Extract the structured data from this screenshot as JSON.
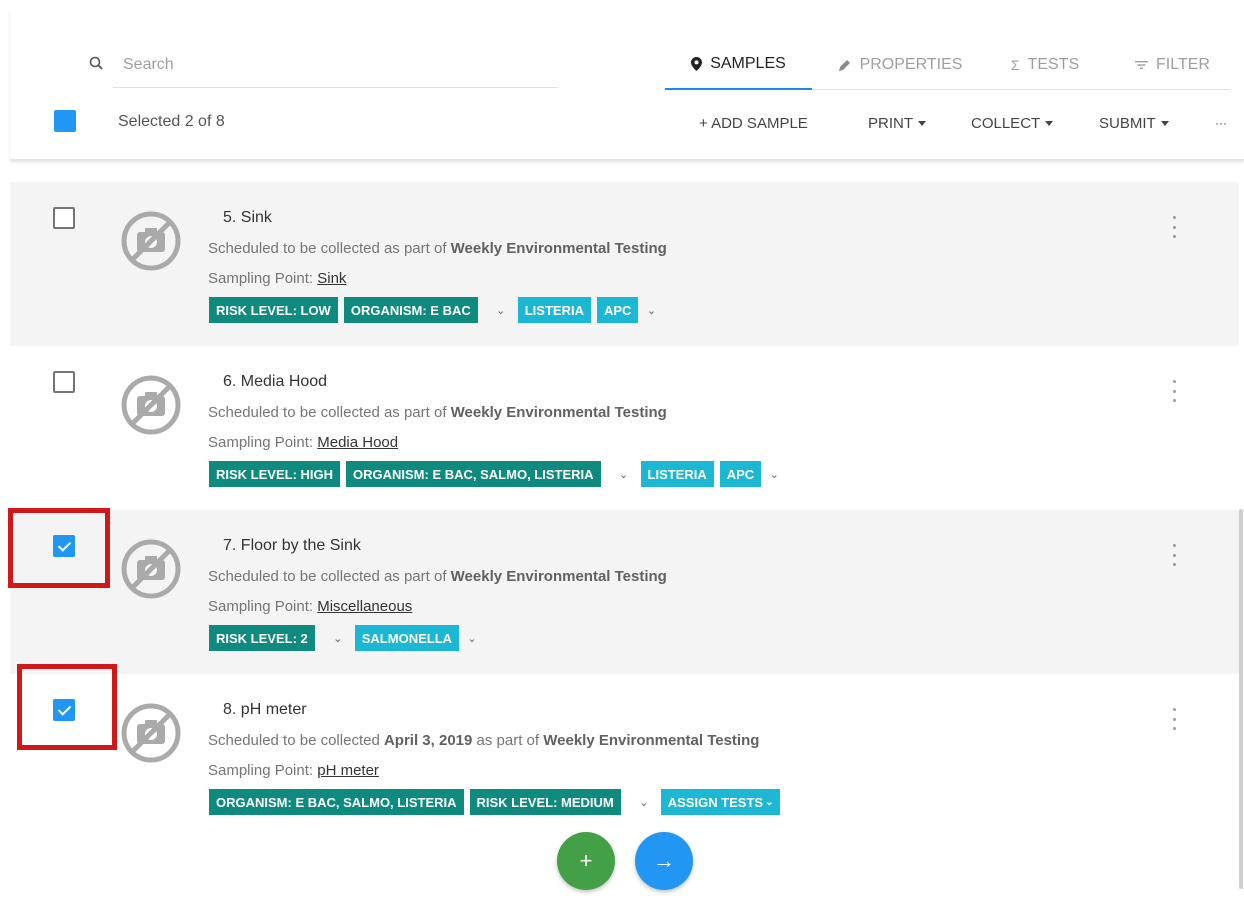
{
  "search": {
    "placeholder": "Search"
  },
  "tabs": [
    {
      "label": "SAMPLES",
      "icon": "map-pin-icon",
      "active": true
    },
    {
      "label": "PROPERTIES",
      "icon": "pencil-icon",
      "active": false
    },
    {
      "label": "TESTS",
      "icon": "sigma-icon",
      "active": false
    },
    {
      "label": "FILTER",
      "icon": "filter-lines-icon",
      "active": false
    }
  ],
  "selection": {
    "text": "Selected 2 of 8"
  },
  "actions": {
    "add_sample": "+ ADD SAMPLE",
    "print": "PRINT",
    "collect": "COLLECT",
    "submit": "SUBMIT",
    "more": "···"
  },
  "colors": {
    "accent": "#2196f3",
    "chip_teal": "#0f8a7e",
    "chip_cyan": "#1cb7d2",
    "highlight": "#d0181a",
    "fab_green": "#43a047"
  },
  "samples": [
    {
      "title": "5. Sink",
      "sched_prefix": "Scheduled to be collected as part of",
      "sched_date": "",
      "sched_plan": "Weekly Environmental Testing",
      "sp_label": "Sampling Point:",
      "sp_value": "Sink",
      "checked": false,
      "tags_a": [
        "RISK LEVEL: LOW",
        "ORGANISM: E BAC"
      ],
      "tags_b": [
        "LISTERIA",
        "APC"
      ]
    },
    {
      "title": "6. Media Hood",
      "sched_prefix": "Scheduled to be collected as part of",
      "sched_date": "",
      "sched_plan": "Weekly Environmental Testing",
      "sp_label": "Sampling Point:",
      "sp_value": "Media Hood",
      "checked": false,
      "tags_a": [
        "RISK LEVEL: HIGH",
        "ORGANISM: E BAC, SALMO, LISTERIA"
      ],
      "tags_b": [
        "LISTERIA",
        "APC"
      ]
    },
    {
      "title": "7. Floor by the Sink",
      "sched_prefix": "Scheduled to be collected as part of",
      "sched_date": "",
      "sched_plan": "Weekly Environmental Testing",
      "sp_label": "Sampling Point:",
      "sp_value": "Miscellaneous",
      "checked": true,
      "tags_a": [
        "RISK LEVEL: 2"
      ],
      "tags_b": [
        "SALMONELLA"
      ]
    },
    {
      "title": "8. pH meter",
      "sched_prefix": "Scheduled to be collected",
      "sched_date": "April 3, 2019",
      "sched_mid": "as part of",
      "sched_plan": "Weekly Environmental Testing",
      "sp_label": "Sampling Point:",
      "sp_value": "pH meter",
      "checked": true,
      "tags_a": [
        "ORGANISM: E BAC, SALMO, LISTERIA",
        "RISK LEVEL: MEDIUM"
      ],
      "tags_b": [
        "ASSIGN TESTS"
      ]
    }
  ],
  "fabs": {
    "add": "+",
    "next": "→"
  }
}
